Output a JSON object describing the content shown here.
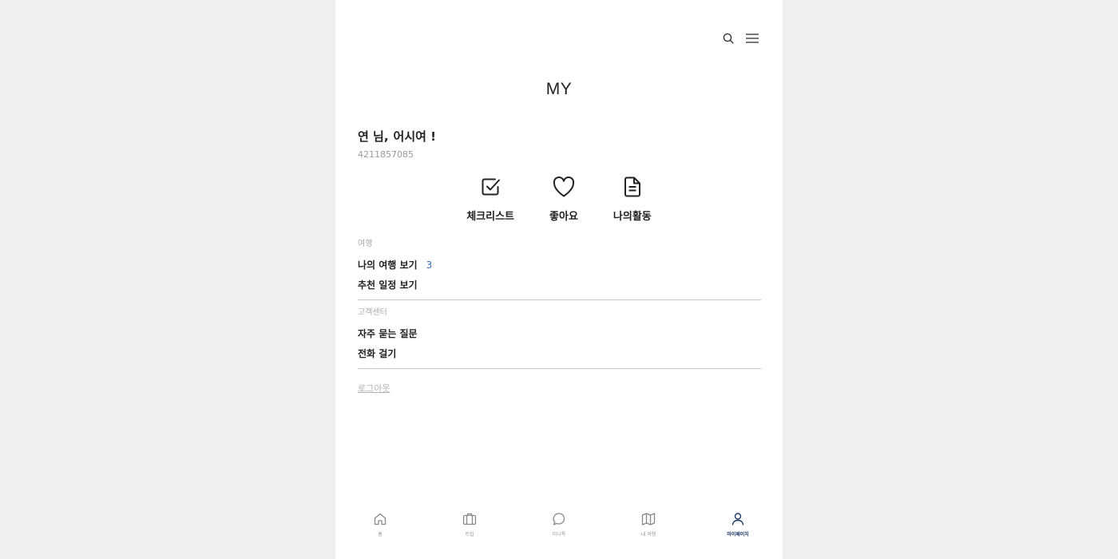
{
  "header": {
    "title": "MY"
  },
  "user": {
    "name": "연 님,",
    "greeting": "어시여 !",
    "id": "4211857085"
  },
  "quick_actions": [
    {
      "label": "체크리스트",
      "icon": "checkbox-icon"
    },
    {
      "label": "좋아요",
      "icon": "heart-icon"
    },
    {
      "label": "나의활동",
      "icon": "document-icon"
    }
  ],
  "sections": {
    "trip": {
      "title": "여행",
      "items": [
        {
          "label": "나의 여행 보기",
          "count": "3"
        },
        {
          "label": "추천 일정 보기"
        }
      ]
    },
    "support": {
      "title": "고객센터",
      "items": [
        {
          "label": "자주 묻는 질문"
        },
        {
          "label": "전화 걸기"
        }
      ]
    }
  },
  "logout_label": "로그아웃",
  "bottom_nav": [
    {
      "label": "홈",
      "icon": "home-icon",
      "active": false
    },
    {
      "label": "트립",
      "icon": "suitcase-icon",
      "active": false
    },
    {
      "label": "미니톡",
      "icon": "chat-icon",
      "active": false
    },
    {
      "label": "내 여행",
      "icon": "map-icon",
      "active": false
    },
    {
      "label": "마이페이지",
      "icon": "user-icon",
      "active": true
    }
  ],
  "colors": {
    "accent": "#3c6cb4",
    "nav_active": "#1f3a68",
    "background": "#efefef"
  }
}
